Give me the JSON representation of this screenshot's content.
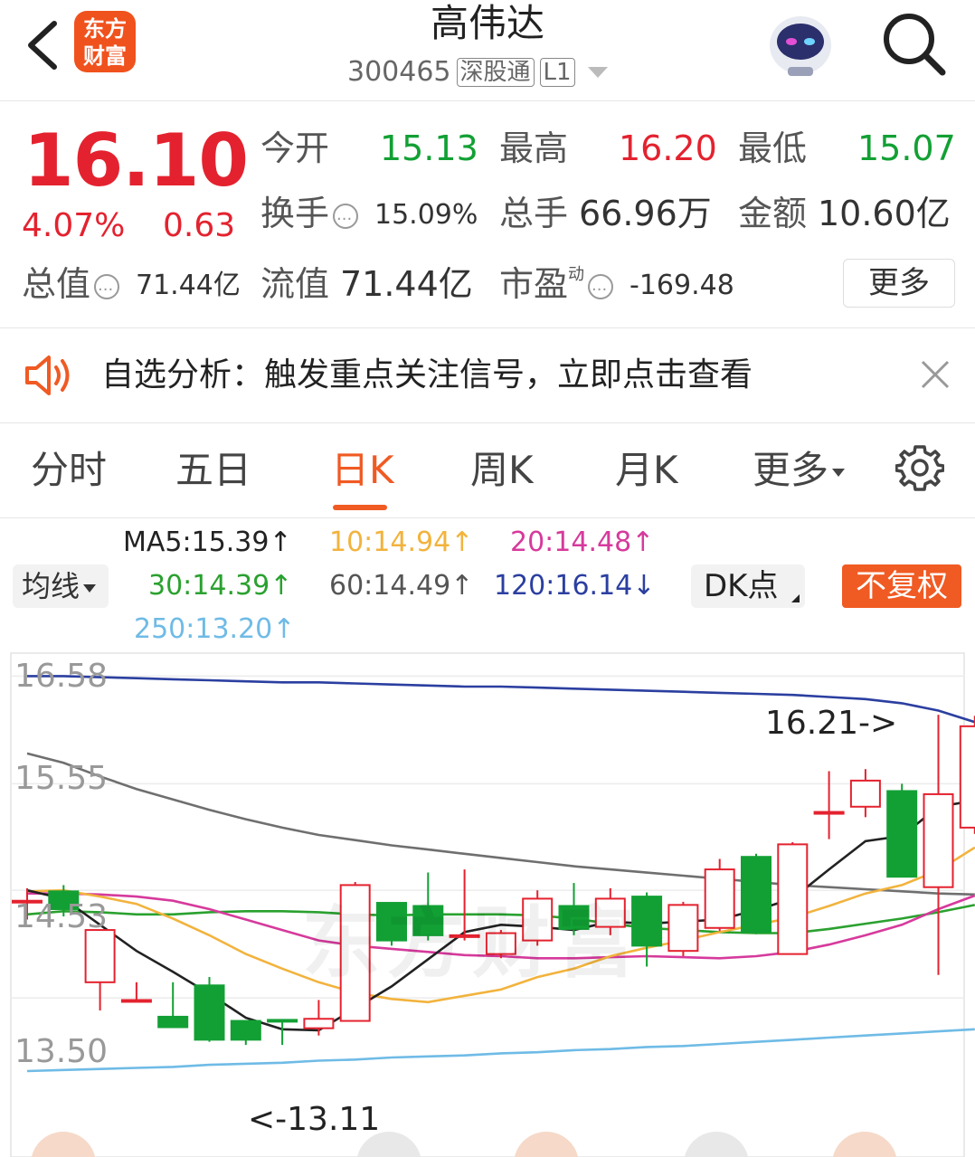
{
  "header": {
    "logo_line1": "东方",
    "logo_line2": "财富",
    "title": "高伟达",
    "code": "300465",
    "tag1": "深股通",
    "tag2": "L1"
  },
  "quote": {
    "price": "16.10",
    "change_pct": "4.07%",
    "change": "0.63",
    "open_label": "今开",
    "open": "15.13",
    "high_label": "最高",
    "high": "16.20",
    "low_label": "最低",
    "low": "15.07",
    "turnover_label": "换手",
    "turnover": "15.09%",
    "volume_label": "总手",
    "volume": "66.96万",
    "amount_label": "金额",
    "amount": "10.60亿",
    "mktcap_label": "总值",
    "mktcap": "71.44亿",
    "float_label": "流值",
    "float": "71.44亿",
    "pe_label": "市盈",
    "pe_sup": "动",
    "pe": "-169.48",
    "more_label": "更多"
  },
  "banner": {
    "text": "自选分析：触发重点关注信号，立即点击查看"
  },
  "tabs": [
    "分时",
    "五日",
    "日K",
    "周K",
    "月K",
    "更多"
  ],
  "ma": {
    "dropdown": "均线",
    "ma5": "MA5:15.39↑",
    "ma10": "10:14.94↑",
    "ma20": "20:14.48↑",
    "ma30": "30:14.39↑",
    "ma60": "60:14.49↑",
    "ma120": "120:16.14↓",
    "ma250": "250:13.20↑",
    "dk": "DK点",
    "fq": "不复权"
  },
  "colors": {
    "up": "#e4222f",
    "down": "#12a034",
    "accent": "#f05a23",
    "ma5": "#222222",
    "ma10": "#f2b33d",
    "ma20": "#d63a9c",
    "ma30": "#2aa12f",
    "ma60": "#6f6f6f",
    "ma120": "#2b3fa0",
    "ma250": "#6fbbe6"
  },
  "chart_data": {
    "type": "candlestick",
    "y_ticks": [
      "16.58",
      "15.55",
      "14.53",
      "13.50"
    ],
    "ylim": [
      12.8,
      16.8
    ],
    "annotations": {
      "high": "16.21->",
      "low": "<-13.11"
    },
    "watermark": "东方财富",
    "candles": [
      {
        "o": 14.43,
        "h": 14.55,
        "l": 14.25,
        "c": 14.43
      },
      {
        "o": 14.52,
        "h": 14.58,
        "l": 14.28,
        "c": 14.35
      },
      {
        "o": 13.65,
        "h": 14.15,
        "l": 13.38,
        "c": 14.15
      },
      {
        "o": 13.48,
        "h": 13.65,
        "l": 13.48,
        "c": 13.48
      },
      {
        "o": 13.32,
        "h": 13.65,
        "l": 13.32,
        "c": 13.22
      },
      {
        "o": 13.62,
        "h": 13.7,
        "l": 13.08,
        "c": 13.1
      },
      {
        "o": 13.28,
        "h": 13.28,
        "l": 13.05,
        "c": 13.1
      },
      {
        "o": 13.29,
        "h": 13.29,
        "l": 13.05,
        "c": 13.28
      },
      {
        "o": 13.21,
        "h": 13.48,
        "l": 13.14,
        "c": 13.3
      },
      {
        "o": 13.28,
        "h": 14.61,
        "l": 13.28,
        "c": 14.58
      },
      {
        "o": 14.41,
        "h": 14.41,
        "l": 14.0,
        "c": 14.05
      },
      {
        "o": 14.38,
        "h": 14.7,
        "l": 14.05,
        "c": 14.1
      },
      {
        "o": 14.1,
        "h": 14.73,
        "l": 14.05,
        "c": 14.1
      },
      {
        "o": 13.92,
        "h": 14.15,
        "l": 13.88,
        "c": 14.12
      },
      {
        "o": 14.05,
        "h": 14.53,
        "l": 14.0,
        "c": 14.45
      },
      {
        "o": 14.38,
        "h": 14.6,
        "l": 14.1,
        "c": 14.16
      },
      {
        "o": 14.18,
        "h": 14.55,
        "l": 14.1,
        "c": 14.45
      },
      {
        "o": 14.47,
        "h": 14.51,
        "l": 13.8,
        "c": 14.0
      },
      {
        "o": 13.95,
        "h": 14.42,
        "l": 13.9,
        "c": 14.39
      },
      {
        "o": 14.17,
        "h": 14.83,
        "l": 14.14,
        "c": 14.73
      },
      {
        "o": 14.85,
        "h": 14.88,
        "l": 14.11,
        "c": 14.13
      },
      {
        "o": 13.92,
        "h": 14.99,
        "l": 13.92,
        "c": 14.97
      },
      {
        "o": 15.27,
        "h": 15.67,
        "l": 15.02,
        "c": 15.28
      },
      {
        "o": 15.33,
        "h": 15.69,
        "l": 15.23,
        "c": 15.58
      },
      {
        "o": 15.48,
        "h": 15.55,
        "l": 14.66,
        "c": 14.66
      },
      {
        "o": 14.56,
        "h": 16.21,
        "l": 13.72,
        "c": 15.45
      },
      {
        "o": 15.13,
        "h": 16.2,
        "l": 15.07,
        "c": 16.1
      }
    ],
    "ma5": [
      14.53,
      14.45,
      14.2,
      13.95,
      13.75,
      13.54,
      13.31,
      13.2,
      13.19,
      13.4,
      13.61,
      13.87,
      14.13,
      14.2,
      14.18,
      14.15,
      14.23,
      14.21,
      14.23,
      14.25,
      14.34,
      14.45,
      14.73,
      15.0,
      15.05,
      15.33,
      15.39
    ],
    "ma10": [
      14.52,
      14.53,
      14.47,
      14.4,
      14.26,
      14.1,
      13.92,
      13.78,
      13.65,
      13.55,
      13.49,
      13.46,
      13.52,
      13.58,
      13.7,
      13.78,
      13.9,
      13.98,
      14.05,
      14.13,
      14.2,
      14.27,
      14.38,
      14.5,
      14.58,
      14.72,
      14.94
    ],
    "ma20": [
      14.5,
      14.5,
      14.49,
      14.47,
      14.43,
      14.35,
      14.25,
      14.15,
      14.05,
      14.0,
      13.97,
      13.94,
      13.91,
      13.9,
      13.88,
      13.88,
      13.89,
      13.9,
      13.89,
      13.88,
      13.9,
      13.94,
      14.01,
      14.1,
      14.2,
      14.35,
      14.48
    ],
    "ma30": [
      14.3,
      14.33,
      14.32,
      14.3,
      14.3,
      14.32,
      14.33,
      14.33,
      14.32,
      14.3,
      14.29,
      14.3,
      14.3,
      14.3,
      14.29,
      14.26,
      14.21,
      14.17,
      14.15,
      14.13,
      14.12,
      14.12,
      14.16,
      14.21,
      14.26,
      14.32,
      14.39
    ],
    "ma60": [
      15.84,
      15.75,
      15.62,
      15.5,
      15.4,
      15.3,
      15.21,
      15.13,
      15.06,
      15.01,
      14.96,
      14.92,
      14.88,
      14.84,
      14.8,
      14.76,
      14.73,
      14.7,
      14.67,
      14.64,
      14.61,
      14.58,
      14.56,
      14.54,
      14.52,
      14.5,
      14.49
    ],
    "ma120": [
      16.58,
      16.58,
      16.57,
      16.56,
      16.55,
      16.54,
      16.53,
      16.52,
      16.52,
      16.51,
      16.5,
      16.49,
      16.48,
      16.48,
      16.47,
      16.46,
      16.45,
      16.44,
      16.43,
      16.42,
      16.41,
      16.4,
      16.38,
      16.36,
      16.32,
      16.25,
      16.14
    ],
    "ma250": [
      12.8,
      12.81,
      12.82,
      12.83,
      12.84,
      12.86,
      12.87,
      12.88,
      12.9,
      12.91,
      12.93,
      12.94,
      12.95,
      12.97,
      12.98,
      13.0,
      13.01,
      13.03,
      13.04,
      13.06,
      13.08,
      13.1,
      13.12,
      13.14,
      13.16,
      13.18,
      13.2
    ]
  }
}
